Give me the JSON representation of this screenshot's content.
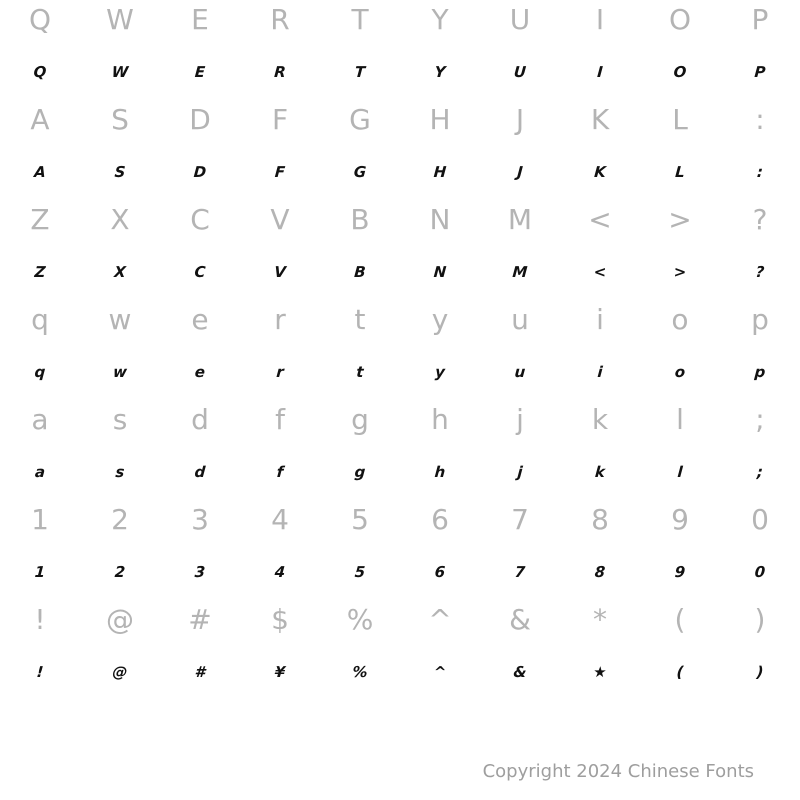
{
  "rows": [
    {
      "reference": [
        "Q",
        "W",
        "E",
        "R",
        "T",
        "Y",
        "U",
        "I",
        "O",
        "P"
      ],
      "sample": [
        "Q",
        "W",
        "E",
        "R",
        "T",
        "Y",
        "U",
        "I",
        "O",
        "P"
      ]
    },
    {
      "reference": [
        "A",
        "S",
        "D",
        "F",
        "G",
        "H",
        "J",
        "K",
        "L",
        ":"
      ],
      "sample": [
        "A",
        "S",
        "D",
        "F",
        "G",
        "H",
        "J",
        "K",
        "L",
        ":"
      ]
    },
    {
      "reference": [
        "Z",
        "X",
        "C",
        "V",
        "B",
        "N",
        "M",
        "<",
        ">",
        "?"
      ],
      "sample": [
        "Z",
        "X",
        "C",
        "V",
        "B",
        "N",
        "M",
        "<",
        ">",
        "?"
      ]
    },
    {
      "reference": [
        "q",
        "w",
        "e",
        "r",
        "t",
        "y",
        "u",
        "i",
        "o",
        "p"
      ],
      "sample": [
        "q",
        "w",
        "e",
        "r",
        "t",
        "y",
        "u",
        "i",
        "o",
        "p"
      ]
    },
    {
      "reference": [
        "a",
        "s",
        "d",
        "f",
        "g",
        "h",
        "j",
        "k",
        "l",
        ";"
      ],
      "sample": [
        "a",
        "s",
        "d",
        "f",
        "g",
        "h",
        "j",
        "k",
        "l",
        ";"
      ]
    },
    {
      "reference": [
        "1",
        "2",
        "3",
        "4",
        "5",
        "6",
        "7",
        "8",
        "9",
        "0"
      ],
      "sample": [
        "1",
        "2",
        "3",
        "4",
        "5",
        "6",
        "7",
        "8",
        "9",
        "0"
      ]
    },
    {
      "reference": [
        "!",
        "@",
        "#",
        "$",
        "%",
        "^",
        "&",
        "*",
        "(",
        ")"
      ],
      "sample": [
        "!",
        "@",
        "#",
        "¥",
        "%",
        "^",
        "&",
        "★",
        "(",
        ")"
      ]
    }
  ],
  "footer": {
    "copyright": "Copyright 2024 Chinese Fonts"
  }
}
